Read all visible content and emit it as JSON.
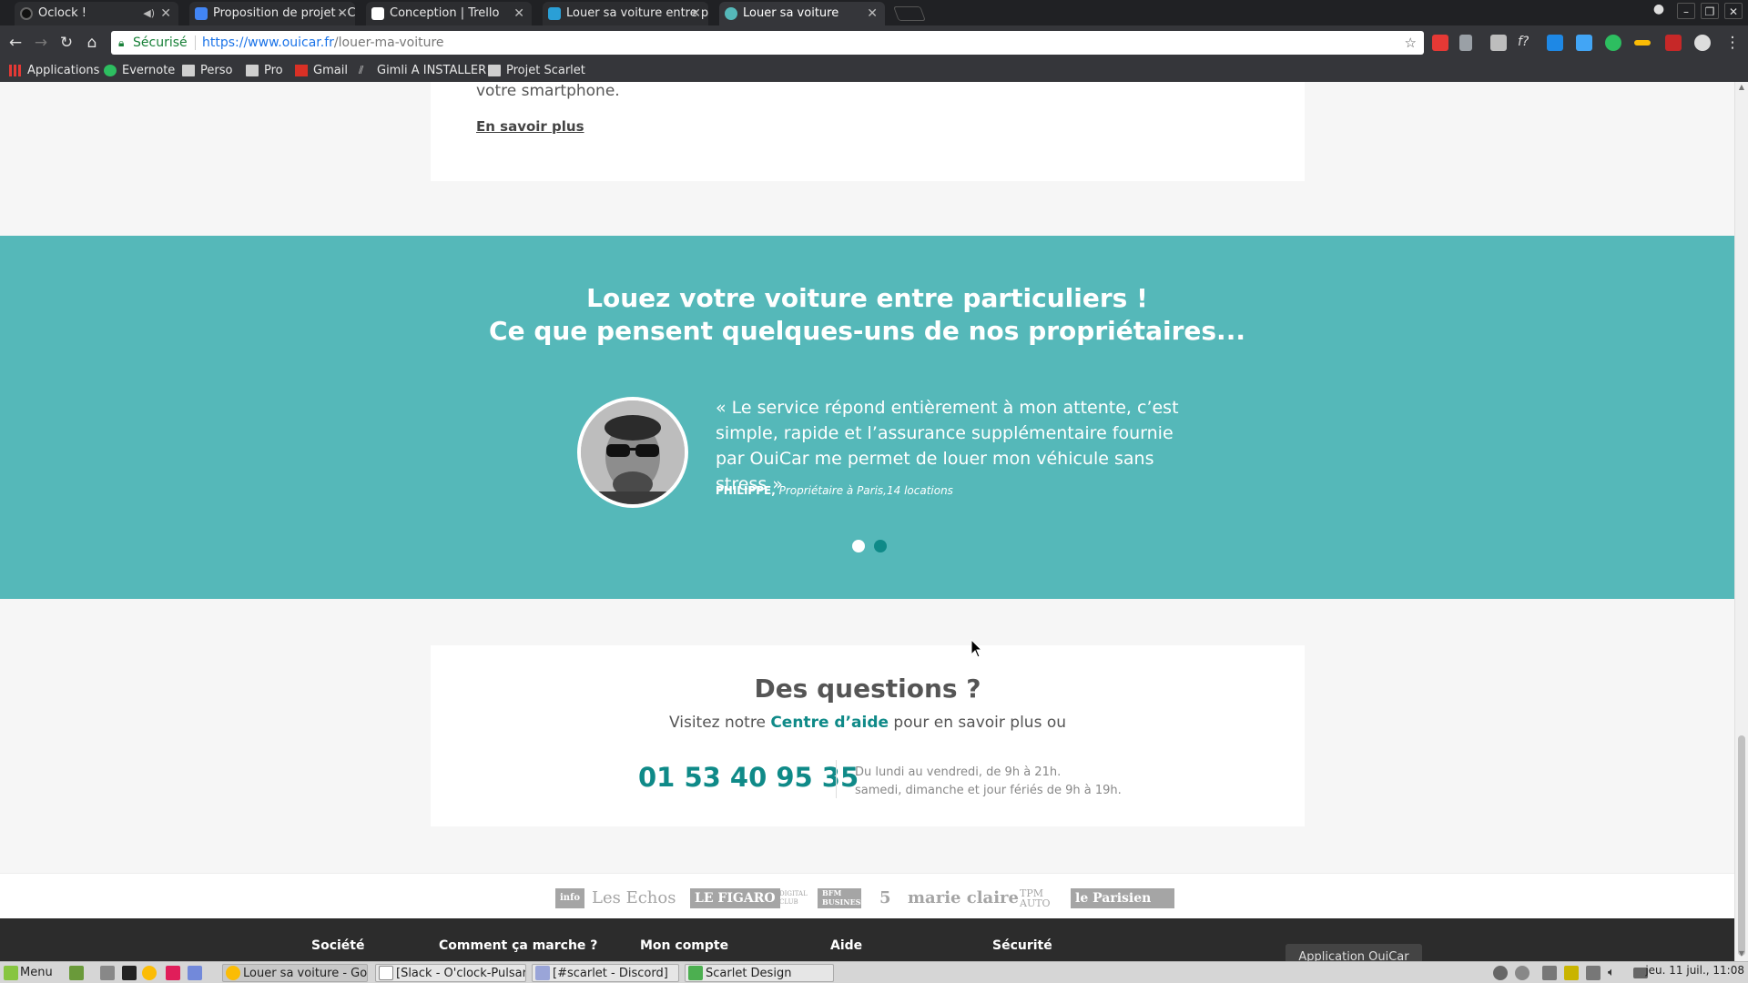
{
  "browser": {
    "tabs": [
      {
        "title": "Oclock !",
        "active": false,
        "favicon_color": "#333333"
      },
      {
        "title": "Proposition de projet - C",
        "active": false,
        "favicon_color": "#4285f4"
      },
      {
        "title": "Conception | Trello",
        "active": false,
        "favicon_color": "#ffffff"
      },
      {
        "title": "Louer sa voiture entre p",
        "active": false,
        "favicon_color": "#2a9fd6"
      },
      {
        "title": "Louer sa voiture",
        "active": true,
        "favicon_color": "#55b8b9"
      }
    ],
    "omnibox": {
      "secure_label": "Sécurisé",
      "url_host": "https://www.ouicar.fr",
      "url_path": "/louer-ma-voiture"
    },
    "bookmarks": [
      {
        "label": "Applications",
        "icon": "apps-grid-icon"
      },
      {
        "label": "Evernote",
        "icon": "evernote-icon"
      },
      {
        "label": "Perso",
        "icon": "folder-icon"
      },
      {
        "label": "Pro",
        "icon": "folder-icon"
      },
      {
        "label": "Gmail",
        "icon": "gmail-icon"
      },
      {
        "label": "Gimli A INSTALLER",
        "icon": "gimli-icon"
      },
      {
        "label": "Projet Scarlet",
        "icon": "folder-icon"
      }
    ]
  },
  "page": {
    "intro": {
      "text_tail": "votre smartphone.",
      "link": "En savoir plus"
    },
    "testimonials": {
      "heading_line1": "Louez votre voiture entre particuliers !",
      "heading_line2": "Ce que pensent quelques-uns de nos propriétaires...",
      "quote": "« Le service répond entièrement à mon attente, c’est simple, rapide et l’assurance supplémentaire fournie par OuiCar me permet de louer mon véhicule sans stress »",
      "author_name": "PHILIPPE,",
      "author_detail": "Propriétaire à Paris,14 locations",
      "carousel_current": 1,
      "carousel_total": 2
    },
    "questions": {
      "heading": "Des questions ?",
      "help_before": "Visitez notre ",
      "help_link": "Centre d’aide",
      "help_after": " pour en savoir plus ou",
      "phone": "01 53 40 95 35",
      "hours_line1": "Du lundi au vendredi, de 9h à 21h.",
      "hours_line2": "samedi, dimanche et jour fériés de 9h à 19h."
    },
    "press_logos": [
      "info",
      "Les Echos",
      "LE FIGARO",
      "DIGITAL CLUB",
      "BFM BUSINESS",
      "5",
      "marie claire",
      "TPM AUTO",
      "le Parisien"
    ],
    "footer": {
      "columns": [
        "Société",
        "Comment ça marche ?",
        "Mon compte",
        "Aide",
        "Sécurité"
      ],
      "app_button": "Application OuiCar"
    }
  },
  "taskbar": {
    "menu_label": "Menu",
    "windows": [
      {
        "title": "Louer sa voiture - Go...",
        "active": true
      },
      {
        "title": "[Slack - O'clock-Pulsar]",
        "active": false
      },
      {
        "title": "[#scarlet - Discord]",
        "active": false
      },
      {
        "title": "Scarlet Design",
        "active": false
      }
    ],
    "clock": "jeu. 11 juil., 11:08"
  },
  "colors": {
    "teal_band": "#55b8b9",
    "teal_text": "#0f8a88",
    "footer_bg": "#2c2c2c"
  }
}
